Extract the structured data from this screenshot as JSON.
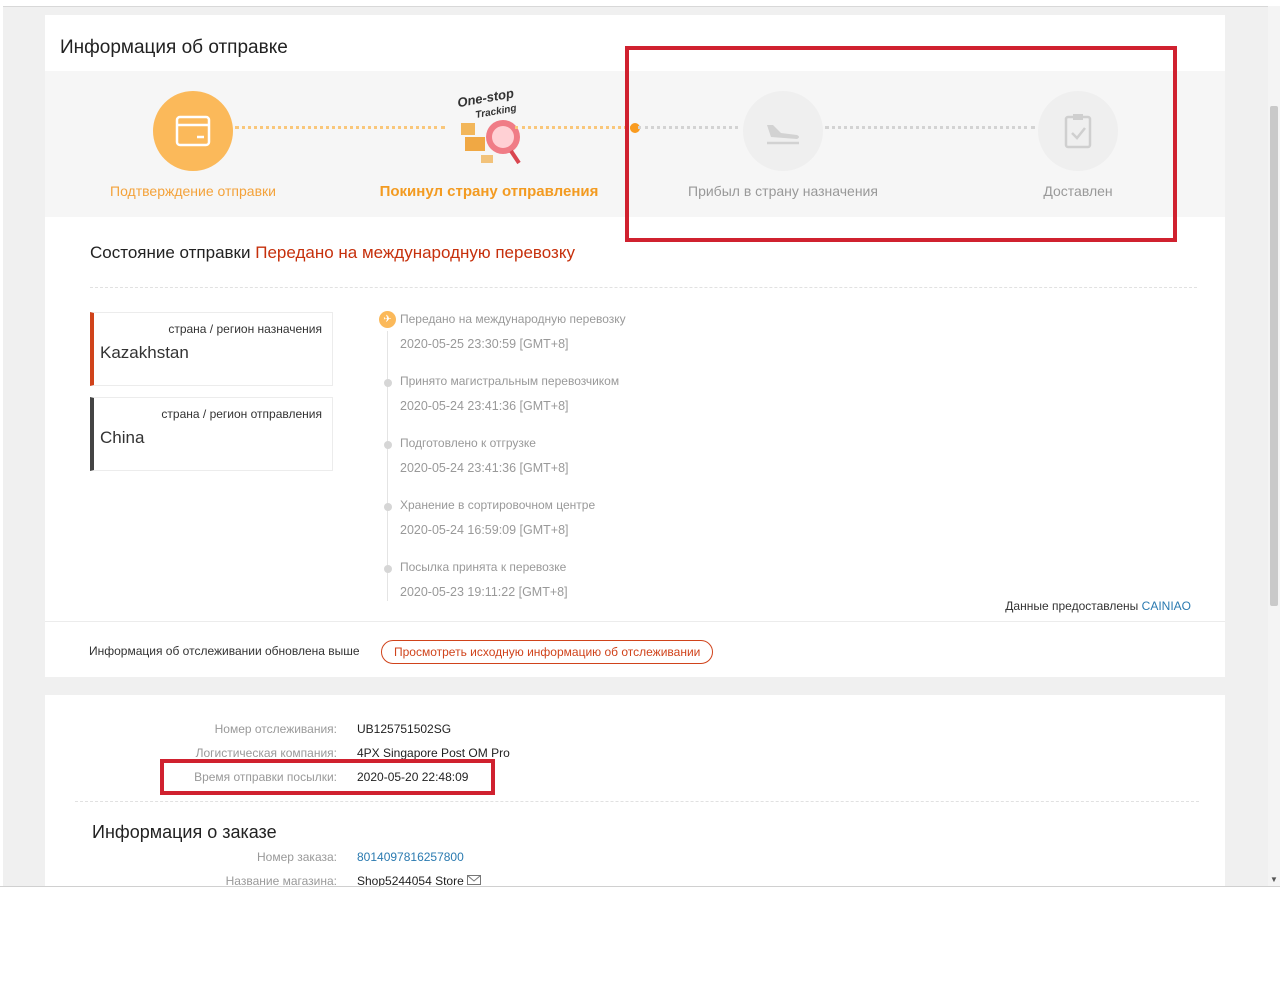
{
  "shipping": {
    "title": "Информация об отправке",
    "steps": [
      {
        "label": "Подтверждение отправки",
        "state": "done",
        "icon": "package-icon"
      },
      {
        "label": "Покинул страну отправления",
        "state": "current",
        "icon": "one-stop-tracking-icon"
      },
      {
        "label": "Прибыл в страну назначения",
        "state": "pending",
        "icon": "plane-landing-icon"
      },
      {
        "label": "Доставлен",
        "state": "pending",
        "icon": "clipboard-check-icon"
      }
    ],
    "onestop_line1": "One-stop",
    "onestop_line2": "Tracking",
    "status_label": "Состояние отправки",
    "status_value": "Передано на международную перевозку",
    "destination": {
      "caption": "страна / регион назначения",
      "value": "Kazakhstan"
    },
    "origin": {
      "caption": "страна / регион отправления",
      "value": "China"
    },
    "timeline": [
      {
        "text": "Передано на международную перевозку",
        "time": "2020-05-25 23:30:59 [GMT+8]"
      },
      {
        "text": "Принято магистральным перевозчиком",
        "time": "2020-05-24 23:41:36 [GMT+8]"
      },
      {
        "text": "Подготовлено к отгрузке",
        "time": "2020-05-24 23:41:36 [GMT+8]"
      },
      {
        "text": "Хранение в сортировочном центре",
        "time": "2020-05-24 16:59:09 [GMT+8]"
      },
      {
        "text": "Посылка принята к перевозке",
        "time": "2020-05-23 19:11:22 [GMT+8]"
      }
    ],
    "provided_prefix": "Данные предоставлены",
    "provider": "CAINIAO",
    "updated_text": "Информация об отслеживании обновлена выше",
    "view_original_button": "Просмотреть исходную информацию об отслеживании"
  },
  "details": {
    "tracking_label": "Номер отслеживания:",
    "tracking_value": "UB125751502SG",
    "logistics_label": "Логистическая компания:",
    "logistics_value": "4PX Singapore Post OM Pro",
    "ship_time_label": "Время отправки посылки:",
    "ship_time_value": "2020-05-20 22:48:09"
  },
  "order": {
    "title": "Информация о заказе",
    "number_label": "Номер заказа:",
    "number_value": "8014097816257800",
    "store_label": "Название магазина:",
    "store_value": "Shop5244054 Store"
  },
  "colors": {
    "accent": "#fbb95a",
    "status_red": "#c6300c",
    "annotation_red": "#d0212f",
    "link": "#2a7ab0"
  }
}
